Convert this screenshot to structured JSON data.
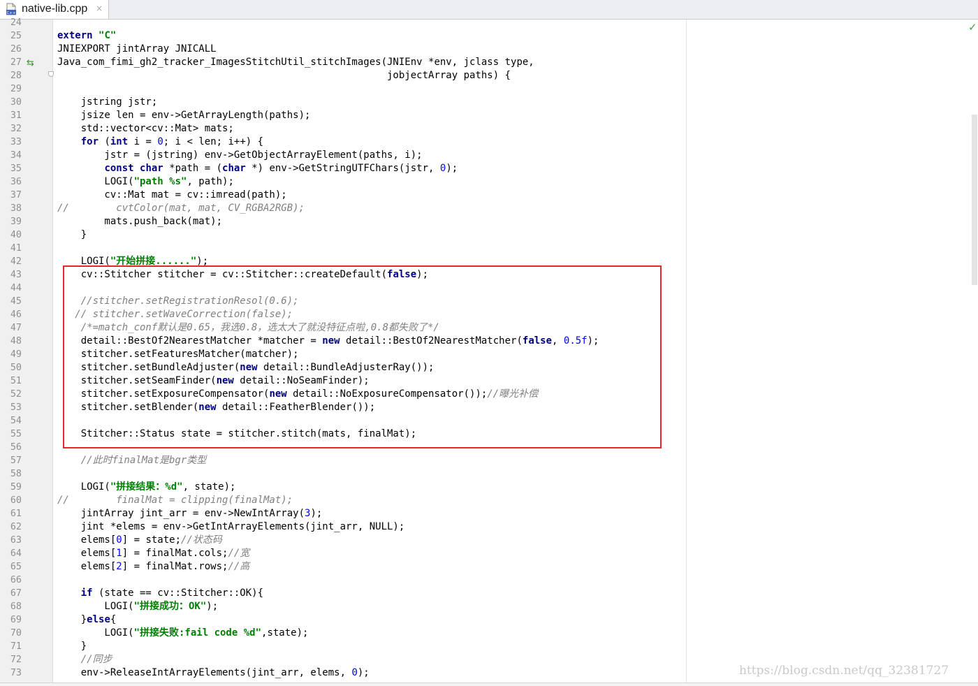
{
  "tab": {
    "filename": "native-lib.cpp",
    "close_glyph": "×",
    "icon": "cpp-file-icon",
    "icon_text": "C++"
  },
  "editor": {
    "lines": [
      {
        "n": "24",
        "segs": []
      },
      {
        "n": "25",
        "segs": [
          {
            "t": "extern",
            "c": "kw"
          },
          {
            "t": " "
          },
          {
            "t": "\"C\"",
            "c": "str"
          }
        ]
      },
      {
        "n": "26",
        "segs": [
          {
            "t": "JNIEXPORT jintArray JNICALL"
          }
        ]
      },
      {
        "n": "27",
        "segs": [
          {
            "t": "Java_com_fimi_gh2_tracker_ImagesStitchUtil_stitchImages(JNIEnv *env, jclass type,"
          }
        ]
      },
      {
        "n": "28",
        "segs": [
          {
            "t": "                                                        jobjectArray paths) {"
          }
        ]
      },
      {
        "n": "29",
        "segs": []
      },
      {
        "n": "30",
        "segs": [
          {
            "t": "    jstring jstr;"
          }
        ]
      },
      {
        "n": "31",
        "segs": [
          {
            "t": "    jsize len = env->GetArrayLength(paths);"
          }
        ]
      },
      {
        "n": "32",
        "segs": [
          {
            "t": "    std::vector<cv::Mat> mats;"
          }
        ]
      },
      {
        "n": "33",
        "segs": [
          {
            "t": "    "
          },
          {
            "t": "for",
            "c": "kw"
          },
          {
            "t": " ("
          },
          {
            "t": "int",
            "c": "kw"
          },
          {
            "t": " i = "
          },
          {
            "t": "0",
            "c": "num"
          },
          {
            "t": "; i < len; i++) {"
          }
        ]
      },
      {
        "n": "34",
        "segs": [
          {
            "t": "        jstr = (jstring) env->GetObjectArrayElement(paths, i);"
          }
        ]
      },
      {
        "n": "35",
        "segs": [
          {
            "t": "        "
          },
          {
            "t": "const char",
            "c": "kw"
          },
          {
            "t": " *path = ("
          },
          {
            "t": "char",
            "c": "kw"
          },
          {
            "t": " *) env->GetStringUTFChars(jstr, "
          },
          {
            "t": "0",
            "c": "num"
          },
          {
            "t": ");"
          }
        ]
      },
      {
        "n": "36",
        "segs": [
          {
            "t": "        LOGI("
          },
          {
            "t": "\"path %s\"",
            "c": "str"
          },
          {
            "t": ", path);"
          }
        ]
      },
      {
        "n": "37",
        "segs": [
          {
            "t": "        cv::Mat mat = cv::imread(path);"
          }
        ]
      },
      {
        "n": "38",
        "segs": [
          {
            "t": "//        cvtColor(mat, mat, CV_RGBA2RGB);",
            "c": "cm"
          }
        ]
      },
      {
        "n": "39",
        "segs": [
          {
            "t": "        mats.push_back(mat);"
          }
        ]
      },
      {
        "n": "40",
        "segs": [
          {
            "t": "    }"
          }
        ]
      },
      {
        "n": "41",
        "segs": []
      },
      {
        "n": "42",
        "segs": [
          {
            "t": "    LOGI("
          },
          {
            "t": "\"开始拼接......\"",
            "c": "str"
          },
          {
            "t": ");"
          }
        ]
      },
      {
        "n": "43",
        "segs": [
          {
            "t": "    cv::Stitcher stitcher = cv::Stitcher::createDefault("
          },
          {
            "t": "false",
            "c": "kw"
          },
          {
            "t": ");"
          }
        ]
      },
      {
        "n": "44",
        "segs": []
      },
      {
        "n": "45",
        "segs": [
          {
            "t": "    //stitcher.setRegistrationResol(0.6);",
            "c": "cm"
          }
        ]
      },
      {
        "n": "46",
        "segs": [
          {
            "t": "   // stitcher.setWaveCorrection(false);",
            "c": "cm"
          }
        ]
      },
      {
        "n": "47",
        "segs": [
          {
            "t": "    /*=match_conf默认是0.65，我选0.8，选太大了就没特征点啦,0.8都失败了*/",
            "c": "cm"
          }
        ]
      },
      {
        "n": "48",
        "segs": [
          {
            "t": "    detail::BestOf2NearestMatcher *matcher = "
          },
          {
            "t": "new",
            "c": "kw"
          },
          {
            "t": " detail::BestOf2NearestMatcher("
          },
          {
            "t": "false",
            "c": "kw"
          },
          {
            "t": ", "
          },
          {
            "t": "0.5f",
            "c": "num"
          },
          {
            "t": ");"
          }
        ]
      },
      {
        "n": "49",
        "segs": [
          {
            "t": "    stitcher.setFeaturesMatcher(matcher);"
          }
        ]
      },
      {
        "n": "50",
        "segs": [
          {
            "t": "    stitcher.setBundleAdjuster("
          },
          {
            "t": "new",
            "c": "kw"
          },
          {
            "t": " detail::BundleAdjusterRay());"
          }
        ]
      },
      {
        "n": "51",
        "segs": [
          {
            "t": "    stitcher.setSeamFinder("
          },
          {
            "t": "new",
            "c": "kw"
          },
          {
            "t": " detail::NoSeamFinder);"
          }
        ]
      },
      {
        "n": "52",
        "segs": [
          {
            "t": "    stitcher.setExposureCompensator("
          },
          {
            "t": "new",
            "c": "kw"
          },
          {
            "t": " detail::NoExposureCompensator());"
          },
          {
            "t": "//曝光补偿",
            "c": "cm"
          }
        ]
      },
      {
        "n": "53",
        "segs": [
          {
            "t": "    stitcher.setBlender("
          },
          {
            "t": "new",
            "c": "kw"
          },
          {
            "t": " detail::FeatherBlender());"
          }
        ]
      },
      {
        "n": "54",
        "segs": []
      },
      {
        "n": "55",
        "segs": [
          {
            "t": "    Stitcher::Status state = stitcher.stitch(mats, finalMat);"
          }
        ]
      },
      {
        "n": "56",
        "segs": []
      },
      {
        "n": "57",
        "segs": [
          {
            "t": "    //此时finalMat是bgr类型",
            "c": "cm"
          }
        ]
      },
      {
        "n": "58",
        "segs": []
      },
      {
        "n": "59",
        "segs": [
          {
            "t": "    LOGI("
          },
          {
            "t": "\"拼接结果：%d\"",
            "c": "str"
          },
          {
            "t": ", state);"
          }
        ]
      },
      {
        "n": "60",
        "segs": [
          {
            "t": "//        finalMat = clipping(finalMat);",
            "c": "cm"
          }
        ]
      },
      {
        "n": "61",
        "segs": [
          {
            "t": "    jintArray jint_arr = env->NewIntArray("
          },
          {
            "t": "3",
            "c": "num"
          },
          {
            "t": ");"
          }
        ]
      },
      {
        "n": "62",
        "segs": [
          {
            "t": "    jint *elems = env->GetIntArrayElements(jint_arr, NULL);"
          }
        ]
      },
      {
        "n": "63",
        "segs": [
          {
            "t": "    elems["
          },
          {
            "t": "0",
            "c": "num"
          },
          {
            "t": "] = state;"
          },
          {
            "t": "//状态码",
            "c": "cm"
          }
        ]
      },
      {
        "n": "64",
        "segs": [
          {
            "t": "    elems["
          },
          {
            "t": "1",
            "c": "num"
          },
          {
            "t": "] = finalMat.cols;"
          },
          {
            "t": "//宽",
            "c": "cm"
          }
        ]
      },
      {
        "n": "65",
        "segs": [
          {
            "t": "    elems["
          },
          {
            "t": "2",
            "c": "num"
          },
          {
            "t": "] = finalMat.rows;"
          },
          {
            "t": "//高",
            "c": "cm"
          }
        ]
      },
      {
        "n": "66",
        "segs": []
      },
      {
        "n": "67",
        "segs": [
          {
            "t": "    "
          },
          {
            "t": "if",
            "c": "kw"
          },
          {
            "t": " (state == cv::Stitcher::OK){"
          }
        ]
      },
      {
        "n": "68",
        "segs": [
          {
            "t": "        LOGI("
          },
          {
            "t": "\"拼接成功：OK\"",
            "c": "str"
          },
          {
            "t": ");"
          }
        ]
      },
      {
        "n": "69",
        "segs": [
          {
            "t": "    }"
          },
          {
            "t": "else",
            "c": "kw"
          },
          {
            "t": "{"
          }
        ]
      },
      {
        "n": "70",
        "segs": [
          {
            "t": "        LOGI("
          },
          {
            "t": "\"拼接失败:fail code %d\"",
            "c": "str"
          },
          {
            "t": ",state);"
          }
        ]
      },
      {
        "n": "71",
        "segs": [
          {
            "t": "    }"
          }
        ]
      },
      {
        "n": "72",
        "segs": [
          {
            "t": "    //同步",
            "c": "cm"
          }
        ]
      },
      {
        "n": "73",
        "segs": [
          {
            "t": "    env->ReleaseIntArrayElements(jint_arr, elems, "
          },
          {
            "t": "0",
            "c": "num"
          },
          {
            "t": ");"
          }
        ]
      }
    ]
  },
  "gutter_icons": {
    "implements_marker": "⇆",
    "fold_marker": "fold-icon"
  },
  "status": {
    "inspection_ok": "✓"
  },
  "watermark": "https://blog.csdn.net/qq_32381727",
  "colors": {
    "highlight_box": "#e5262e",
    "keyword": "#000080",
    "string": "#008000",
    "comment": "#808080",
    "number": "#0000ff"
  }
}
